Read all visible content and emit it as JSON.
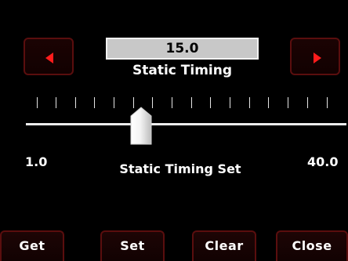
{
  "value": "15.0",
  "title": "Static Timing",
  "subtitle": "Static Timing Set",
  "range": {
    "min": "1.0",
    "max": "40.0"
  },
  "slider": {
    "value": 15.0
  },
  "buttons": {
    "get": "Get",
    "set": "Set",
    "clear": "Clear",
    "close": "Close"
  },
  "icons": {
    "left": "left-triangle-icon",
    "right": "right-triangle-icon"
  },
  "colors": {
    "accent": "#ff1c1c",
    "button_border": "#5a0e0e",
    "value_box": "#c8c8c8"
  }
}
